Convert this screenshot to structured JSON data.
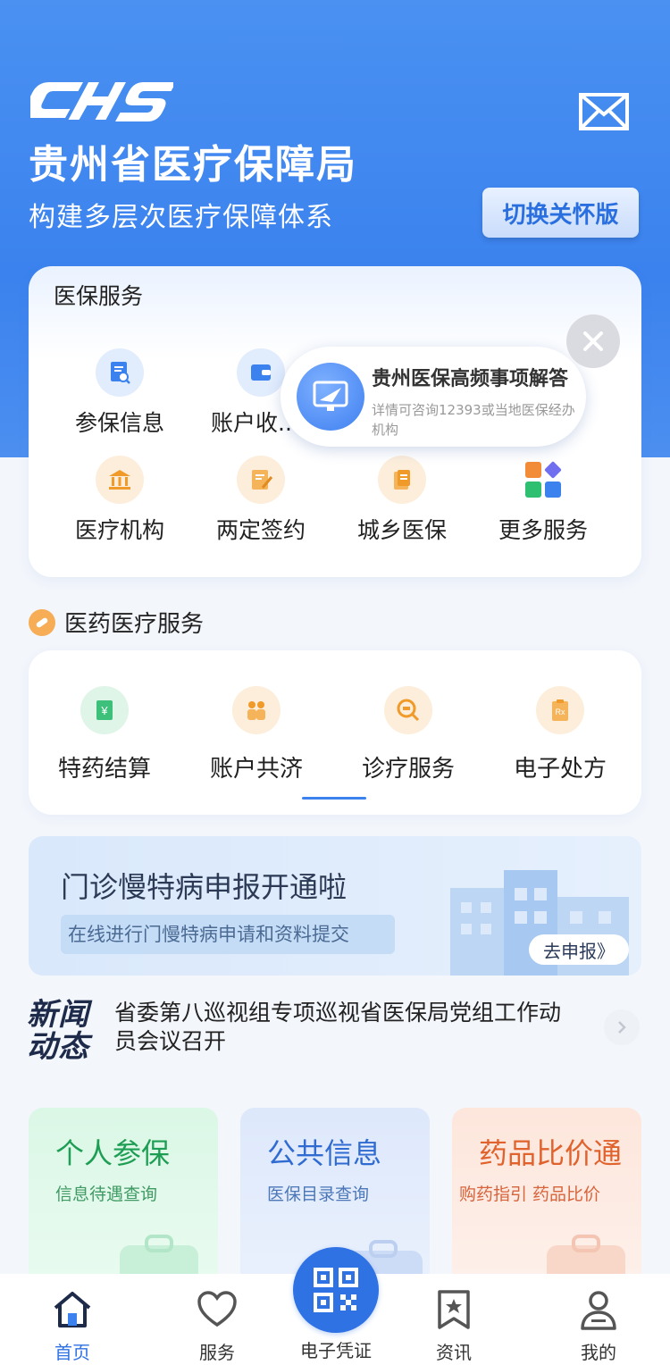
{
  "header": {
    "logo_text": "CHS",
    "org_name": "贵州省医疗保障局",
    "slogan": "构建多层次医疗保障体系",
    "care_button": "切换关怀版"
  },
  "insurance_services": {
    "title": "医保服务",
    "items": [
      {
        "label": "参保信息",
        "icon": "document-search-icon"
      },
      {
        "label": "账户收...",
        "icon": "wallet-icon"
      },
      {
        "label": "医疗机构",
        "icon": "bank-building-icon"
      },
      {
        "label": "两定签约",
        "icon": "sign-contract-icon"
      },
      {
        "label": "城乡医保",
        "icon": "card-icon"
      },
      {
        "label": "更多服务",
        "icon": "apps-grid-icon"
      }
    ]
  },
  "popup": {
    "title": "贵州医保高频事项解答",
    "subtitle": "详情可咨询12393或当地医保经办机构"
  },
  "medical_services": {
    "title": "医药医疗服务",
    "items": [
      {
        "label": "特药结算",
        "icon": "yuan-bill-icon"
      },
      {
        "label": "账户共济",
        "icon": "people-icon"
      },
      {
        "label": "诊疗服务",
        "icon": "medical-search-icon"
      },
      {
        "label": "电子处方",
        "icon": "prescription-icon"
      }
    ]
  },
  "banner": {
    "title": "门诊慢特病申报开通啦",
    "subtitle": "在线进行门慢特病申请和资料提交",
    "button": "去申报》"
  },
  "news": {
    "logo_line1": "新闻",
    "logo_line2": "动态",
    "headline": "省委第八巡视组专项巡视省医保局党组工作动员会议召开"
  },
  "features": [
    {
      "title": "个人参保",
      "subtitle": "信息待遇查询"
    },
    {
      "title": "公共信息",
      "subtitle": "医保目录查询"
    },
    {
      "title": "药品比价通",
      "subtitle": "购药指引 药品比价"
    }
  ],
  "tabbar": {
    "home": "首页",
    "service": "服务",
    "qr": "电子凭证",
    "news": "资讯",
    "mine": "我的"
  },
  "colors": {
    "primary": "#3b82ee",
    "accent_orange": "#f6ad55",
    "green": "#1e9e54",
    "orange": "#e0622c"
  }
}
